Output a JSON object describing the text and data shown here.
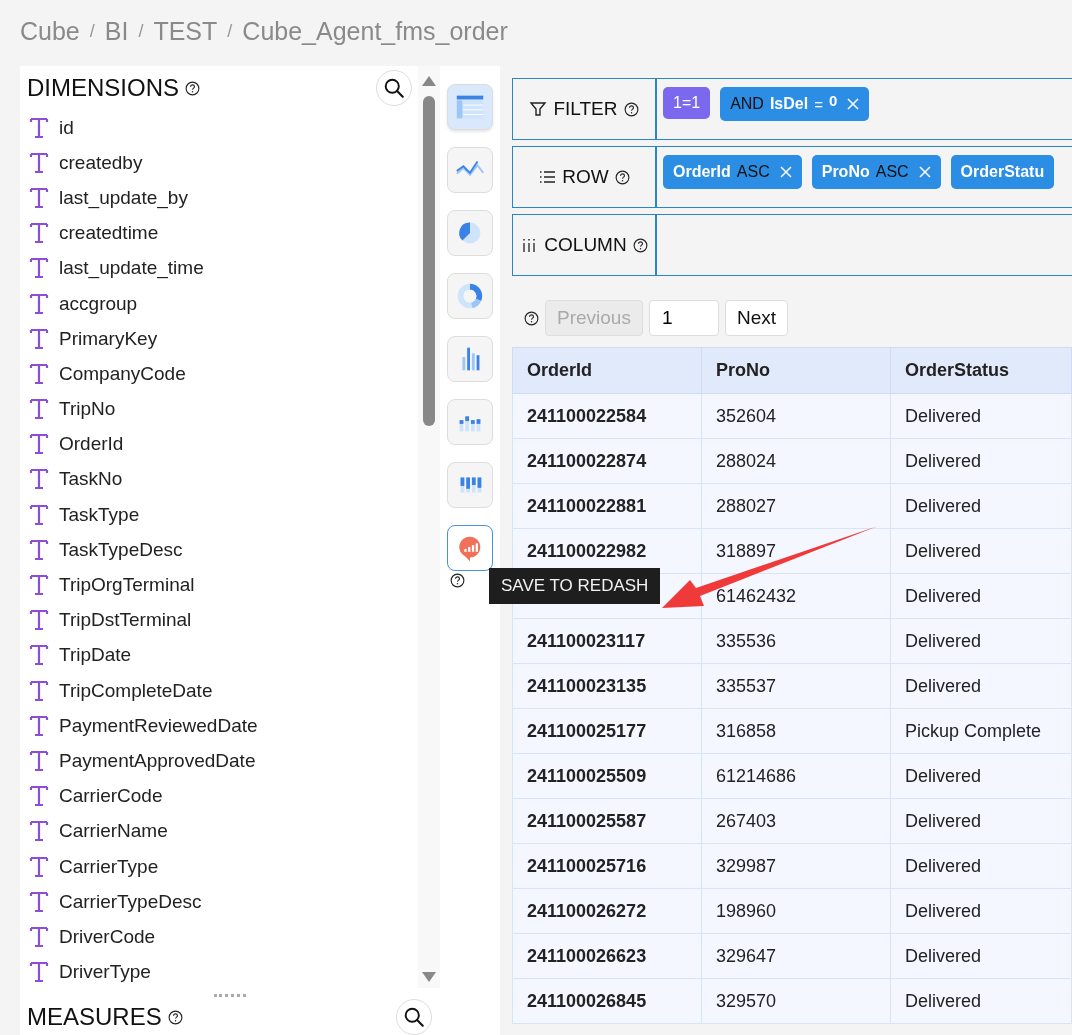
{
  "breadcrumb": [
    {
      "kind": "link",
      "text": "Cube"
    },
    {
      "kind": "separator",
      "text": "/"
    },
    {
      "kind": "link",
      "text": "BI"
    },
    {
      "kind": "separator",
      "text": "/"
    },
    {
      "kind": "link",
      "text": "TEST"
    },
    {
      "kind": "separator",
      "text": "/"
    },
    {
      "kind": "link",
      "text": "Cube_Agent_fms_order"
    }
  ],
  "dimensions": {
    "title": "DIMENSIONS",
    "items": [
      "id",
      "createdby",
      "last_update_by",
      "createdtime",
      "last_update_time",
      "accgroup",
      "PrimaryKey",
      "CompanyCode",
      "TripNo",
      "OrderId",
      "TaskNo",
      "TaskType",
      "TaskTypeDesc",
      "TripOrgTerminal",
      "TripDstTerminal",
      "TripDate",
      "TripCompleteDate",
      "PaymentReviewedDate",
      "PaymentApprovedDate",
      "CarrierCode",
      "CarrierName",
      "CarrierType",
      "CarrierTypeDesc",
      "DriverCode",
      "DriverType"
    ]
  },
  "measures": {
    "title": "MEASURES"
  },
  "chart_types": [
    {
      "kind": "table",
      "selected": true,
      "hovered": false
    },
    {
      "kind": "line",
      "selected": false,
      "hovered": false
    },
    {
      "kind": "pie",
      "selected": false,
      "hovered": false
    },
    {
      "kind": "donut",
      "selected": false,
      "hovered": false
    },
    {
      "kind": "bar",
      "selected": false,
      "hovered": false
    },
    {
      "kind": "stacked",
      "selected": false,
      "hovered": false
    },
    {
      "kind": "columns",
      "selected": false,
      "hovered": false
    },
    {
      "kind": "redash",
      "selected": false,
      "hovered": true
    }
  ],
  "tooltip": "SAVE TO REDASH",
  "filter": {
    "label": "FILTER",
    "pills": [
      {
        "kind": "expr",
        "text": "1=1",
        "color": "#7b68ee"
      },
      {
        "kind": "condition",
        "op": "AND",
        "field": "IsDel",
        "operator": "=",
        "value": "0",
        "color": "#2b8de3"
      }
    ]
  },
  "row": {
    "label": "ROW",
    "pills": [
      {
        "field": "OrderId",
        "order": "ASC"
      },
      {
        "field": "ProNo",
        "order": "ASC"
      },
      {
        "field": "OrderStatu"
      }
    ]
  },
  "column": {
    "label": "COLUMN"
  },
  "pagination": {
    "previous": {
      "label": "Previous",
      "disabled": true
    },
    "page": "1",
    "next": {
      "label": "Next",
      "disabled": false
    }
  },
  "table": {
    "columns": [
      "OrderId",
      "ProNo",
      "OrderStatus"
    ],
    "rows": [
      [
        "241100022584",
        "352604",
        "Delivered"
      ],
      [
        "241100022874",
        "288024",
        "Delivered"
      ],
      [
        "241100022881",
        "288027",
        "Delivered"
      ],
      [
        "241100022982",
        "318897",
        "Delivered"
      ],
      [
        null,
        "61462432",
        "Delivered"
      ],
      [
        "241100023117",
        "335536",
        "Delivered"
      ],
      [
        "241100023135",
        "335537",
        "Delivered"
      ],
      [
        "241100025177",
        "316858",
        "Pickup Complete"
      ],
      [
        "241100025509",
        "61214686",
        "Delivered"
      ],
      [
        "241100025587",
        "267403",
        "Delivered"
      ],
      [
        "241100025716",
        "329987",
        "Delivered"
      ],
      [
        "241100026272",
        "198960",
        "Delivered"
      ],
      [
        "241100026623",
        "329647",
        "Delivered"
      ],
      [
        "241100026845",
        "329570",
        "Delivered"
      ]
    ]
  }
}
